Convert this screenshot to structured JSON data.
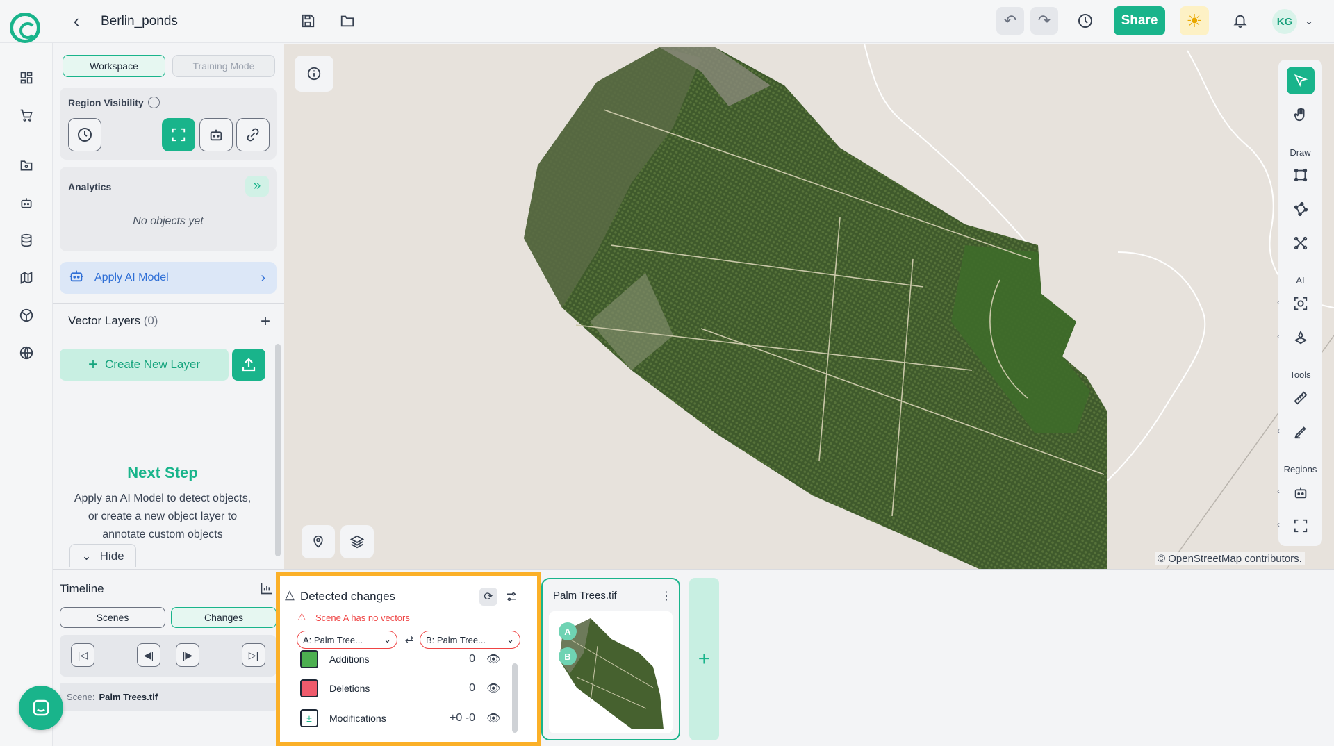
{
  "header": {
    "title": "Berlin_ponds",
    "share_label": "Share",
    "user_initials": "KG"
  },
  "panel": {
    "tabs": [
      {
        "label": "Workspace",
        "active": true
      },
      {
        "label": "Training Mode",
        "active": false
      }
    ],
    "region_visibility": {
      "title": "Region Visibility"
    },
    "analytics": {
      "title": "Analytics",
      "empty": "No objects yet"
    },
    "apply_ai_label": "Apply AI Model",
    "vector_layers": {
      "title": "Vector Layers",
      "count": "(0)"
    },
    "create_layer_label": "Create New Layer",
    "next_step": {
      "title": "Next Step",
      "text": "Apply an AI Model to detect objects, or create a new object layer to annotate custom objects"
    },
    "hide_label": "Hide"
  },
  "map": {
    "attribution": "© OpenStreetMap contributors."
  },
  "toolbar": {
    "sections": {
      "draw": "Draw",
      "ai": "AI",
      "tools": "Tools",
      "regions": "Regions"
    }
  },
  "timeline": {
    "title": "Timeline",
    "tabs": [
      {
        "label": "Scenes",
        "active": false
      },
      {
        "label": "Changes",
        "active": true
      }
    ],
    "scene_prefix": "Scene:",
    "scene_name": "Palm Trees.tif"
  },
  "detected_changes": {
    "title": "Detected changes",
    "warning": "Scene A has no vectors",
    "select_a": "A: Palm Tree...",
    "select_b": "B: Palm Tree...",
    "rows": [
      {
        "label": "Additions",
        "value": "0",
        "color": "#4caf50"
      },
      {
        "label": "Deletions",
        "value": "0",
        "color": "#ef5b6c"
      },
      {
        "label": "Modifications",
        "value": "+0 -0",
        "color": "#ffffff"
      }
    ]
  },
  "scene_card": {
    "title": "Palm Trees.tif",
    "badge_a": "A",
    "badge_b": "B"
  },
  "colors": {
    "accent": "#19b48b",
    "highlight": "#fbb028",
    "warning": "#ef4444"
  }
}
